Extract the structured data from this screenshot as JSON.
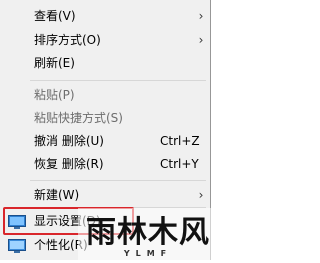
{
  "menu": {
    "items": [
      {
        "label": "查看(V)",
        "has_submenu": true
      },
      {
        "label": "排序方式(O)",
        "has_submenu": true
      },
      {
        "label": "刷新(E)"
      },
      {
        "label": "粘贴(P)",
        "disabled": true
      },
      {
        "label": "粘贴快捷方式(S)",
        "disabled": true
      },
      {
        "label": "撤消 删除(U)",
        "shortcut": "Ctrl+Z"
      },
      {
        "label": "恢复 删除(R)",
        "shortcut": "Ctrl+Y"
      },
      {
        "label": "新建(W)",
        "has_submenu": true
      },
      {
        "label": "显示设置(D)",
        "icon": "monitor-icon",
        "highlighted": true
      },
      {
        "label": "个性化(R)",
        "icon": "personalize-icon"
      }
    ]
  },
  "watermark": {
    "text": "雨林木风",
    "subtext": "YLMF"
  },
  "colors": {
    "highlight_border": "#d9262b",
    "menu_bg": "#f0f0f0"
  }
}
